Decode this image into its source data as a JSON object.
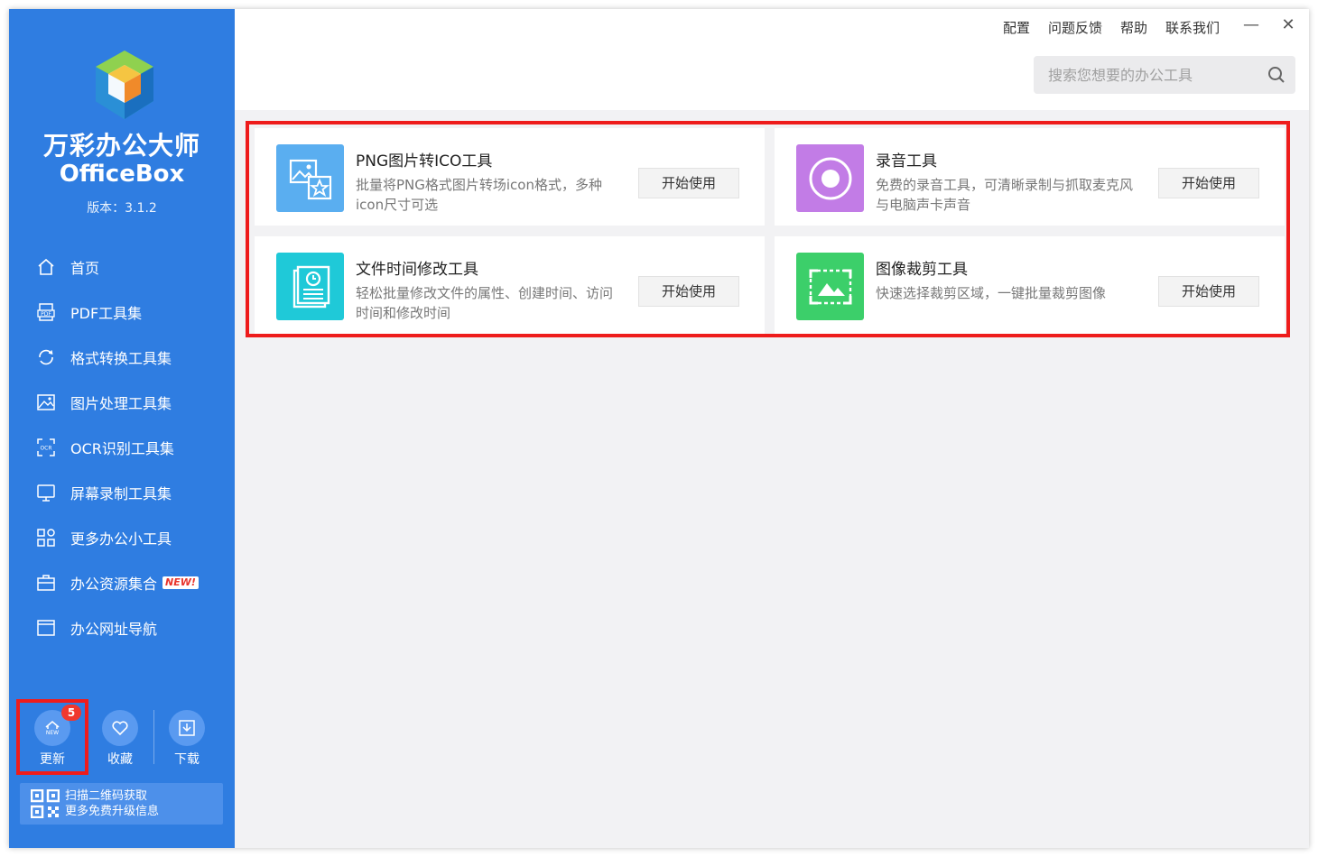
{
  "app": {
    "name_cn": "万彩办公大师",
    "name_en": "OfficeBox",
    "version": "版本：3.1.2"
  },
  "sidebar": {
    "items": [
      {
        "label": "首页",
        "icon": "home-icon"
      },
      {
        "label": "PDF工具集",
        "icon": "pdf-icon"
      },
      {
        "label": "格式转换工具集",
        "icon": "convert-icon"
      },
      {
        "label": "图片处理工具集",
        "icon": "image-icon"
      },
      {
        "label": "OCR识别工具集",
        "icon": "ocr-icon"
      },
      {
        "label": "屏幕录制工具集",
        "icon": "monitor-icon"
      },
      {
        "label": "更多办公小工具",
        "icon": "grid-icon"
      },
      {
        "label": "办公资源集合",
        "icon": "briefcase-icon",
        "tag": "NEW!"
      },
      {
        "label": "办公网址导航",
        "icon": "browser-icon"
      }
    ],
    "actions": {
      "update": {
        "label": "更新",
        "badge": "5"
      },
      "favorite": {
        "label": "收藏"
      },
      "download": {
        "label": "下载"
      }
    },
    "qr": {
      "line1": "扫描二维码获取",
      "line2": "更多免费升级信息"
    }
  },
  "topbar": {
    "links": [
      "配置",
      "问题反馈",
      "帮助",
      "联系我们"
    ],
    "minimize": "—",
    "close": "✕",
    "search_placeholder": "搜索您想要的办公工具"
  },
  "tools": [
    {
      "name": "PNG图片转ICO工具",
      "desc": "批量将PNG格式图片转场icon格式，多种icon尺寸可选",
      "button": "开始使用",
      "icon": "png-to-ico-icon",
      "color": "#5aaef0"
    },
    {
      "name": "录音工具",
      "desc": "免费的录音工具，可清晰录制与抓取麦克风与电脑声卡声音",
      "button": "开始使用",
      "icon": "recorder-icon",
      "color": "#c27ce6"
    },
    {
      "name": "文件时间修改工具",
      "desc": "轻松批量修改文件的属性、创建时间、访问时间和修改时间",
      "button": "开始使用",
      "icon": "file-time-icon",
      "color": "#1fc9d8"
    },
    {
      "name": "图像裁剪工具",
      "desc": "快速选择裁剪区域，一键批量裁剪图像",
      "button": "开始使用",
      "icon": "image-crop-icon",
      "color": "#3ccf6a"
    }
  ]
}
